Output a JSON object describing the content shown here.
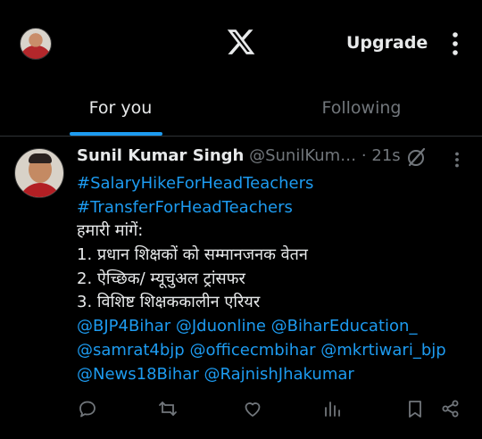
{
  "header": {
    "upgrade_label": "Upgrade",
    "logo_icon": "x-logo-icon",
    "avatar_icon": "profile-avatar"
  },
  "tabs": [
    {
      "label": "For you",
      "active": true
    },
    {
      "label": "Following",
      "active": false
    }
  ],
  "post": {
    "author_name": "Sunil Kumar Singh",
    "handle": "@SunilKum…",
    "separator": "·",
    "time": "21s",
    "lines": [
      {
        "text": "#SalaryHikeForHeadTeachers",
        "link": true
      },
      {
        "text": "#TransferForHeadTeachers",
        "link": true
      },
      {
        "text": "हमारी मांगें:",
        "link": false
      },
      {
        "text": "1. प्रधान शिक्षकों को सम्मानजनक वेतन",
        "link": false
      },
      {
        "text": "2. ऐच्छिक/ म्यूचुअल ट्रांसफर",
        "link": false
      },
      {
        "text": "3. विशिष्ट शिक्षककालीन एरियर",
        "link": false
      },
      {
        "text": "@BJP4Bihar @Jduonline @BiharEducation_",
        "link": true
      },
      {
        "text": "@samrat4bjp @officecmbihar @mkrtiwari_bjp",
        "link": true
      },
      {
        "text": "@News18Bihar @RajnishJhakumar",
        "link": true
      }
    ],
    "action_icons": [
      "reply-icon",
      "repost-icon",
      "like-icon",
      "views-icon",
      "bookmark-icon",
      "share-icon"
    ]
  },
  "colors": {
    "background": "#000000",
    "text": "#e7e9ea",
    "muted": "#71767b",
    "accent": "#1d9bf0",
    "divider": "#2f3336"
  }
}
